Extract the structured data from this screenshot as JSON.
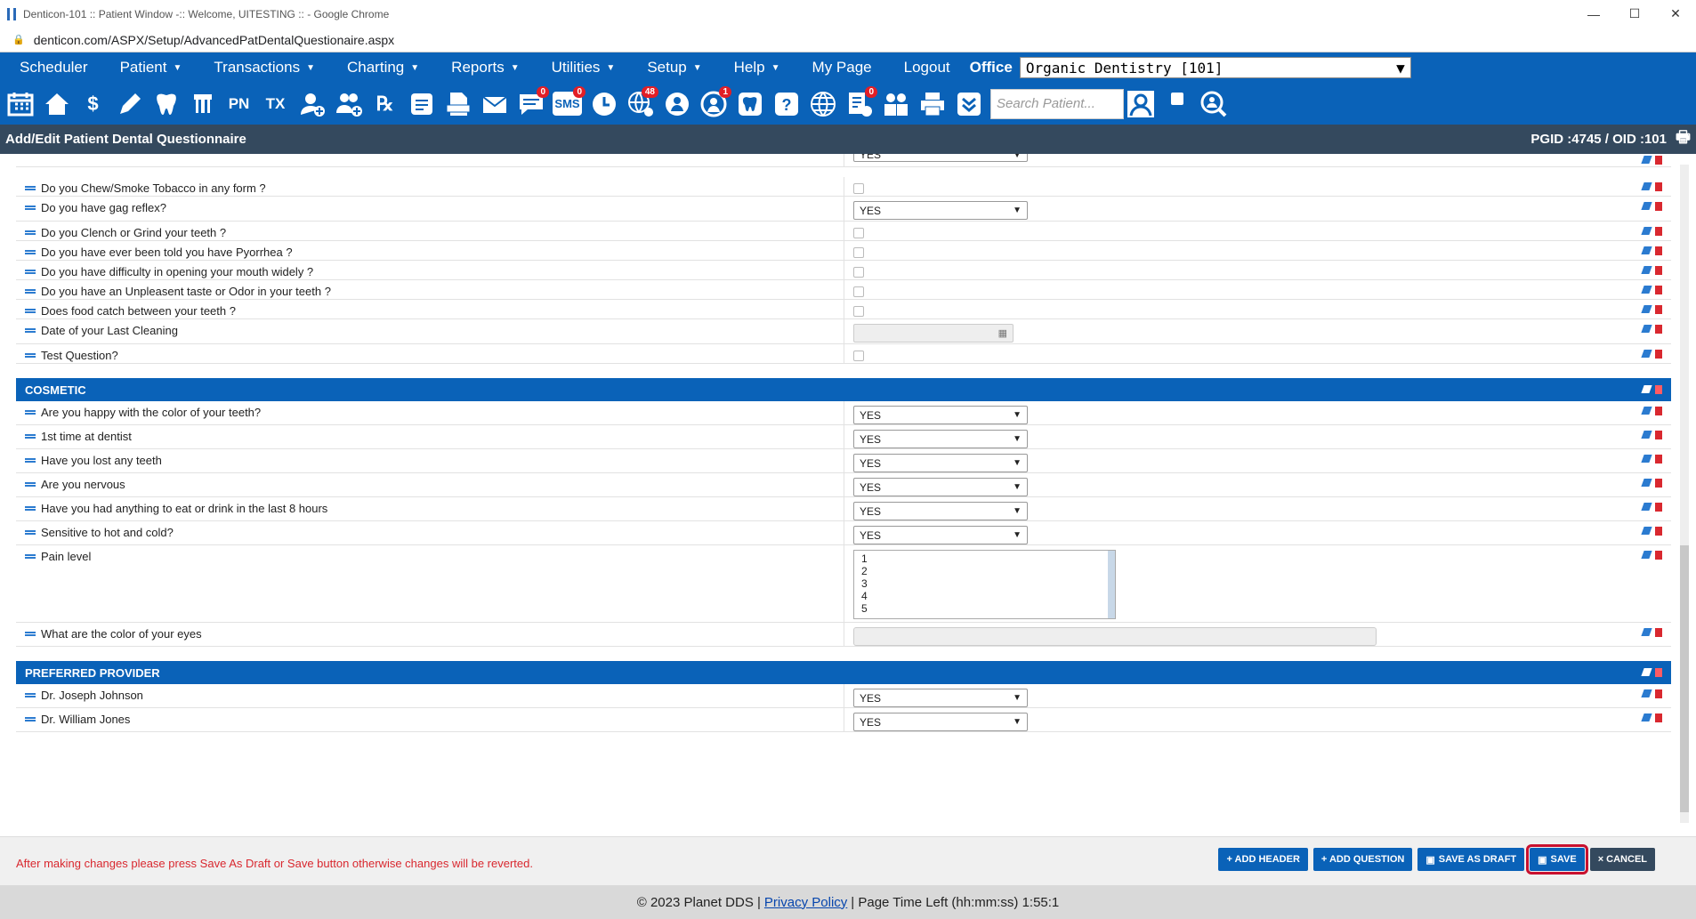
{
  "window": {
    "title": "Denticon-101 :: Patient Window -:: Welcome, UITESTING :: - Google Chrome",
    "url": "denticon.com/ASPX/Setup/AdvancedPatDentalQuestionaire.aspx"
  },
  "menu": {
    "items": [
      {
        "label": "Scheduler",
        "has_caret": false
      },
      {
        "label": "Patient",
        "has_caret": true
      },
      {
        "label": "Transactions",
        "has_caret": true
      },
      {
        "label": "Charting",
        "has_caret": true
      },
      {
        "label": "Reports",
        "has_caret": true
      },
      {
        "label": "Utilities",
        "has_caret": true
      },
      {
        "label": "Setup",
        "has_caret": true
      },
      {
        "label": "Help",
        "has_caret": true
      },
      {
        "label": "My Page",
        "has_caret": false
      },
      {
        "label": "Logout",
        "has_caret": false
      }
    ],
    "office_label": "Office",
    "office_value": "Organic Dentistry [101]"
  },
  "toolbar": {
    "badges": {
      "messages": "0",
      "sms": "0",
      "web": "48",
      "patient_alert": "1",
      "notes": "0"
    },
    "search_placeholder": "Search Patient..."
  },
  "page_header": {
    "title": "Add/Edit Patient Dental Questionnaire",
    "ids": "PGID :4745  /  OID :101"
  },
  "sections": {
    "cosmetic": "COSMETIC",
    "preferred_provider": "PREFERRED PROVIDER"
  },
  "questions": {
    "q_partial": "YES",
    "q1": "Do you Chew/Smoke Tobacco in any form ?",
    "q2": "Do you have gag reflex?",
    "q2_value": "YES",
    "q3": "Do you Clench or Grind your teeth ?",
    "q4": "Do you have ever been told you have Pyorrhea ?",
    "q5": "Do you have difficulty in opening your mouth widely ?",
    "q6": "Do you have an Unpleasent taste or Odor in your teeth ?",
    "q7": "Does food catch between your teeth ?",
    "q8": "Date of your Last Cleaning",
    "q9": "Test Question?",
    "c1": "Are you happy with the color of your teeth?",
    "c1_value": "YES",
    "c2": "1st time at dentist",
    "c2_value": "YES",
    "c3": "Have you lost any teeth",
    "c3_value": "YES",
    "c4": "Are you nervous",
    "c4_value": "YES",
    "c5": "Have you had anything to eat or drink in the last 8 hours",
    "c5_value": "YES",
    "c6": "Sensitive to hot and cold?",
    "c6_value": "YES",
    "c7": "Pain level",
    "c7_options": [
      "1",
      "2",
      "3",
      "4",
      "5"
    ],
    "c8": "What are the color of your eyes",
    "p1": "Dr. Joseph Johnson",
    "p1_value": "YES",
    "p2": "Dr. William Jones",
    "p2_value": "YES"
  },
  "footer": {
    "warning": "After making changes please press Save As Draft or Save button otherwise changes will be reverted.",
    "add_header": "+ ADD HEADER",
    "add_question": "+ ADD QUESTION",
    "save_as_draft": "SAVE AS DRAFT",
    "save": "SAVE",
    "cancel": "× CANCEL"
  },
  "copyright": {
    "text": "© 2023 Planet DDS |",
    "privacy": "Privacy Policy",
    "time_left": "|  Page Time Left (hh:mm:ss) 1:55:1"
  },
  "colors": {
    "brand_blue": "#0a62b8",
    "header_dark": "#34495e",
    "warning_red": "#d9282f",
    "save_highlight": "#c8102e"
  }
}
